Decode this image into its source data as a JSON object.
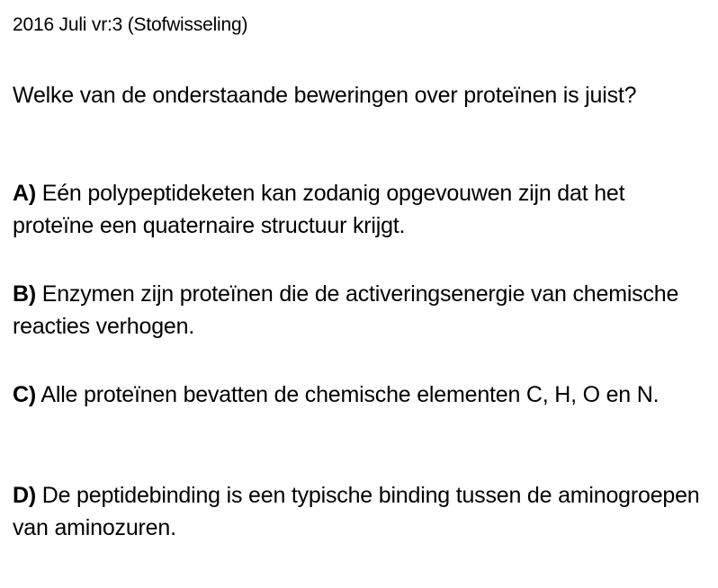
{
  "header": "2016 Juli vr:3 (Stofwisseling)",
  "question": "Welke van de onderstaande beweringen over proteïnen is juist?",
  "options": [
    {
      "letter": "A)",
      "text": "Eén polypeptideketen kan zodanig opgevouwen zijn dat het proteïne een quaternaire structuur krijgt."
    },
    {
      "letter": "B)",
      "text": "Enzymen zijn proteïnen die de activeringsenergie van chemische reacties verhogen."
    },
    {
      "letter": "C)",
      "text": "Alle proteïnen bevatten de chemische elementen C, H, O en N."
    },
    {
      "letter": "D)",
      "text": "De peptidebinding is een typische binding tussen de aminogroepen van aminozuren."
    }
  ]
}
